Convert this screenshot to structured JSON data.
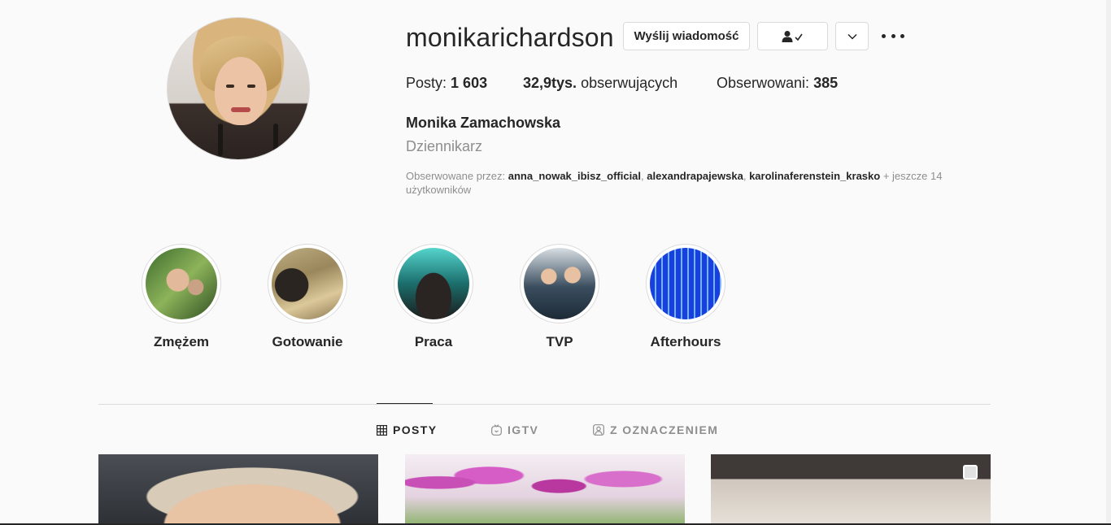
{
  "profile": {
    "username": "monikarichardson",
    "full_name": "Monika Zamachowska",
    "category": "Dziennikarz",
    "buttons": {
      "message": "Wyślij wiadomość"
    },
    "stats": {
      "posts_label": "Posty:",
      "posts_value": "1 603",
      "followers_value": "32,9tys.",
      "followers_label": "obserwujących",
      "following_label": "Obserwowani:",
      "following_value": "385"
    },
    "followed_by": {
      "prefix": "Obserwowane przez:",
      "accounts": [
        "anna_nowak_ibisz_official",
        "alexandrapajewska",
        "karolinaferenstein_krasko"
      ],
      "sep": ",",
      "suffix": "+ jeszcze 14 użytkowników"
    }
  },
  "highlights": [
    {
      "label": "Zmężem"
    },
    {
      "label": "Gotowanie"
    },
    {
      "label": "Praca"
    },
    {
      "label": "TVP"
    },
    {
      "label": "Afterhours"
    }
  ],
  "tabs": [
    {
      "label": "POSTY",
      "icon": "grid-icon",
      "active": true
    },
    {
      "label": "IGTV",
      "icon": "igtv-icon",
      "active": false
    },
    {
      "label": "Z OZNACZENIEM",
      "icon": "tagged-icon",
      "active": false
    }
  ],
  "colors": {
    "background": "#fafafa",
    "text": "#262626",
    "secondary": "#8e8e8e",
    "border": "#dbdbdb"
  }
}
